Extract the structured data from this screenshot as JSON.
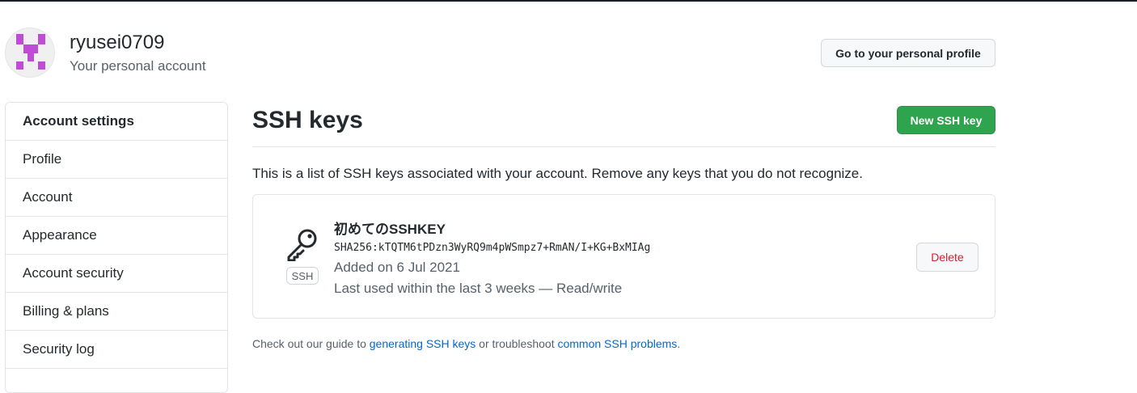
{
  "header": {
    "username": "ryusei0709",
    "subtitle": "Your personal account",
    "profile_button": "Go to your personal profile",
    "avatar_color": "#c04bd4"
  },
  "sidebar": {
    "items": [
      {
        "label": "Account settings"
      },
      {
        "label": "Profile"
      },
      {
        "label": "Account"
      },
      {
        "label": "Appearance"
      },
      {
        "label": "Account security"
      },
      {
        "label": "Billing & plans"
      },
      {
        "label": "Security log"
      }
    ]
  },
  "main": {
    "title": "SSH keys",
    "new_button": "New SSH key",
    "description": "This is a list of SSH keys associated with your account. Remove any keys that you do not recognize.",
    "keys": [
      {
        "icon": "key-icon",
        "badge": "SSH",
        "title": "初めてのSSHKEY",
        "fingerprint": "SHA256:kTQTM6tPDzn3WyRQ9m4pWSmpz7+RmAN/I+KG+BxMIAg",
        "added": "Added on 6 Jul 2021",
        "last_used": "Last used within the last 3 weeks — Read/write",
        "delete_label": "Delete"
      }
    ],
    "footer": {
      "prefix": "Check out our guide to ",
      "link1": "generating SSH keys",
      "middle": " or troubleshoot ",
      "link2": "common SSH problems",
      "suffix": "."
    }
  },
  "colors": {
    "primary_green": "#2ea44f",
    "danger": "#cb2431",
    "link": "#0366d6"
  }
}
